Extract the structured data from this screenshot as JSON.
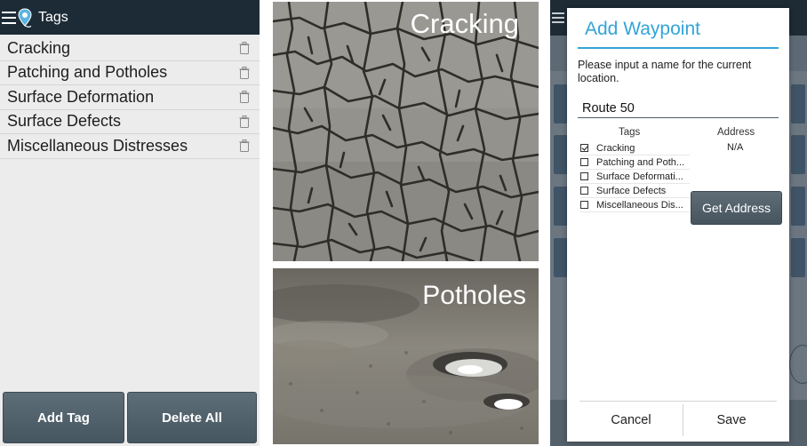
{
  "tags_screen": {
    "title": "Tags",
    "tags": [
      {
        "label": "Cracking"
      },
      {
        "label": "Patching and Potholes"
      },
      {
        "label": "Surface Deformation"
      },
      {
        "label": "Surface Defects"
      },
      {
        "label": "Miscellaneous Distresses"
      }
    ],
    "buttons": {
      "add_tag": "Add Tag",
      "delete_all": "Delete All"
    }
  },
  "photos": {
    "cracking_caption": "Cracking",
    "potholes_caption": "Potholes"
  },
  "waypoint_dialog": {
    "title": "Add Waypoint",
    "prompt": "Please input a name for the current location.",
    "name_value": "Route 50",
    "tags_header": "Tags",
    "address_header": "Address",
    "address_value": "N/A",
    "tag_options": [
      {
        "label": "Cracking",
        "checked": true
      },
      {
        "label": "Patching and Poth...",
        "checked": false
      },
      {
        "label": "Surface Deformati...",
        "checked": false
      },
      {
        "label": "Surface Defects",
        "checked": false
      },
      {
        "label": "Miscellaneous Dis...",
        "checked": false
      }
    ],
    "get_address_label": "Get Address",
    "cancel_label": "Cancel",
    "save_label": "Save"
  },
  "colors": {
    "app_bar": "#1c2b36",
    "accent": "#33a4d9",
    "button": "#52616b",
    "list_background": "#ececec"
  },
  "icons": [
    "menu-icon",
    "app-logo-icon",
    "trash-icon"
  ]
}
